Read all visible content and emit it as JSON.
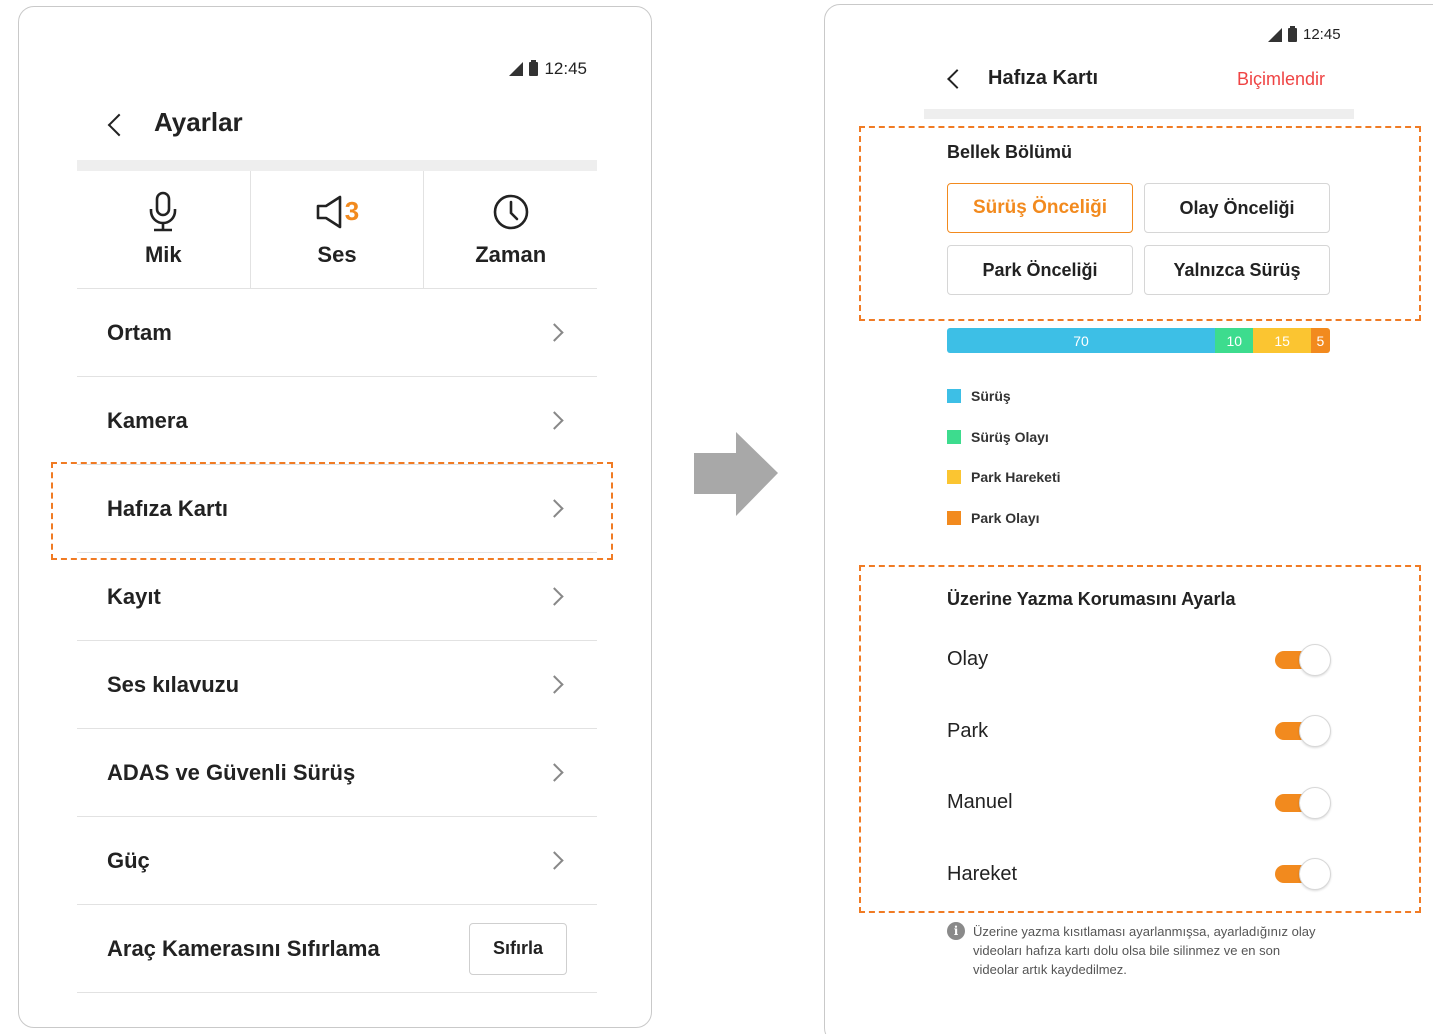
{
  "left_screen": {
    "status": {
      "time": "12:45"
    },
    "header": {
      "title": "Ayarlar"
    },
    "quick": [
      {
        "icon": "microphone-icon",
        "label": "Mik"
      },
      {
        "icon": "speaker-icon",
        "label": "Ses",
        "badge": "3"
      },
      {
        "icon": "clock-icon",
        "label": "Zaman"
      }
    ],
    "menu": [
      {
        "label": "Ortam"
      },
      {
        "label": "Kamera"
      },
      {
        "label": "Hafıza Kartı",
        "highlighted": true
      },
      {
        "label": "Kayıt"
      },
      {
        "label": "Ses kılavuzu"
      },
      {
        "label": "ADAS ve Güvenli Sürüş"
      },
      {
        "label": "Güç"
      },
      {
        "label": "Araç Kamerasını Sıfırlama",
        "button": "Sıfırla"
      }
    ]
  },
  "arrow": {
    "icon": "arrow-right-icon",
    "color": "#a8a8a8"
  },
  "right_screen": {
    "status": {
      "time": "12:45"
    },
    "header": {
      "title": "Hafıza Kartı",
      "action": "Biçimlendir"
    },
    "partition": {
      "title": "Bellek Bölümü",
      "options": [
        {
          "label": "Sürüş Önceliği",
          "selected": true
        },
        {
          "label": "Olay Önceliği",
          "selected": false
        },
        {
          "label": "Park Önceliği",
          "selected": false
        },
        {
          "label": "Yalnızca Sürüş",
          "selected": false
        }
      ]
    },
    "allocation": [
      {
        "name": "Sürüş",
        "value": 70,
        "label": "70",
        "color": "#3dbfe6"
      },
      {
        "name": "Sürüş Olayı",
        "value": 10,
        "label": "10",
        "color": "#3ddc8e"
      },
      {
        "name": "Park Hareketi",
        "value": 15,
        "label": "15",
        "color": "#fbc531"
      },
      {
        "name": "Park Olayı",
        "value": 5,
        "label": "5",
        "color": "#f28a1e"
      }
    ],
    "protection": {
      "title": "Üzerine Yazma Korumasını Ayarla",
      "items": [
        {
          "label": "Olay",
          "on": true
        },
        {
          "label": "Park",
          "on": true
        },
        {
          "label": "Manuel",
          "on": true
        },
        {
          "label": "Hareket",
          "on": true
        }
      ]
    },
    "info": {
      "icon": "info-icon",
      "text": "Üzerine yazma kısıtlaması ayarlanmışsa, ayarladığınız olay videoları hafıza kartı dolu olsa bile silinmez ve en son videolar artık kaydedilmez."
    }
  },
  "colors": {
    "accent": "#f28a1e",
    "highlight_border": "#f07b24",
    "format_action": "#ef4444"
  }
}
